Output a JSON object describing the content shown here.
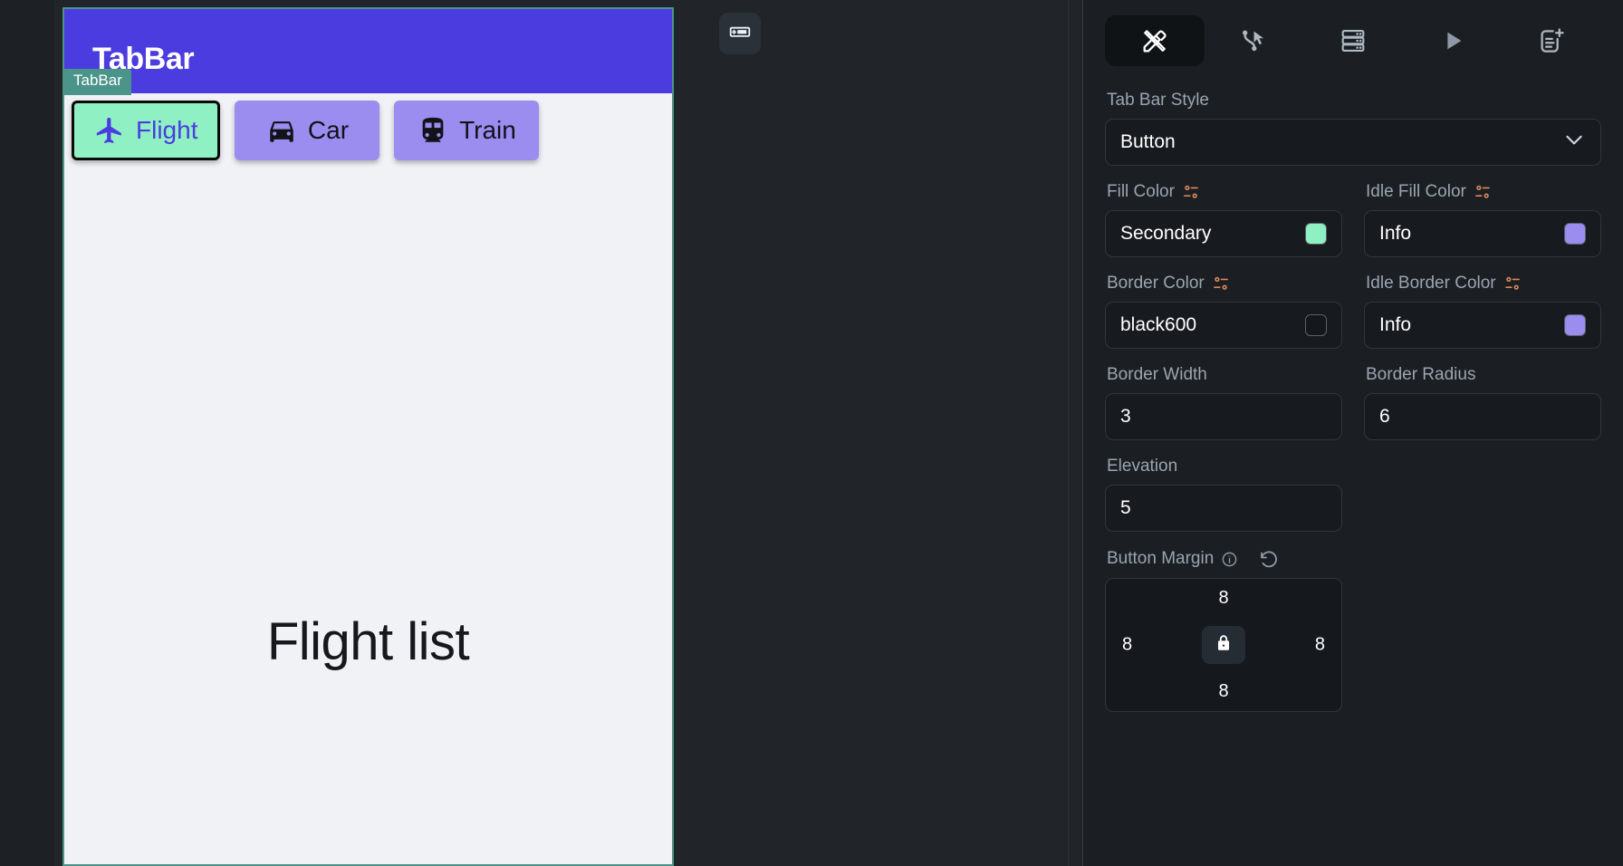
{
  "canvas": {
    "device_badge": "TabBar",
    "appbar_title": "TabBar",
    "body_text": "Flight list",
    "tabs": [
      {
        "label": "Flight",
        "icon": "airplane-icon",
        "state": "active",
        "fill": "#8ff0c4",
        "text_color": "#4b3ce0",
        "border": "#0a0a0a"
      },
      {
        "label": "Car",
        "icon": "car-icon",
        "state": "idle",
        "fill": "#9b8cf0",
        "text_color": "#111318",
        "border": "#9b8cf0"
      },
      {
        "label": "Train",
        "icon": "train-icon",
        "state": "idle",
        "fill": "#9b8cf0",
        "text_color": "#111318",
        "border": "#9b8cf0"
      }
    ],
    "chip_icon": "device-frame-icon",
    "appbar_color": "#4b3ce0",
    "frame_outline_color": "#4b9489",
    "surface_color": "#f1f2f6"
  },
  "toolbar": {
    "items": [
      {
        "name": "design-tools-icon",
        "label": "Design",
        "active": true
      },
      {
        "name": "interactions-cursor-icon",
        "label": "Interactions",
        "active": false
      },
      {
        "name": "data-store-icon",
        "label": "Data",
        "active": false
      },
      {
        "name": "play-run-icon",
        "label": "Run",
        "active": false
      },
      {
        "name": "add-document-icon",
        "label": "Add page",
        "active": false
      }
    ]
  },
  "properties": {
    "tab_bar_style": {
      "label": "Tab Bar Style",
      "value": "Button"
    },
    "fill_color": {
      "label": "Fill Color",
      "value": "Secondary",
      "swatch": "#8ff0c4"
    },
    "idle_fill_color": {
      "label": "Idle Fill Color",
      "value": "Info",
      "swatch": "#9b8cf0"
    },
    "border_color": {
      "label": "Border Color",
      "value": "black600",
      "swatch": "#14181c"
    },
    "idle_border_color": {
      "label": "Idle Border Color",
      "value": "Info",
      "swatch": "#9b8cf0"
    },
    "border_width": {
      "label": "Border Width",
      "value": "3"
    },
    "border_radius": {
      "label": "Border Radius",
      "value": "6"
    },
    "elevation": {
      "label": "Elevation",
      "value": "5"
    },
    "button_margin": {
      "label": "Button Margin",
      "top": "8",
      "right": "8",
      "bottom": "8",
      "left": "8",
      "locked": true
    }
  }
}
